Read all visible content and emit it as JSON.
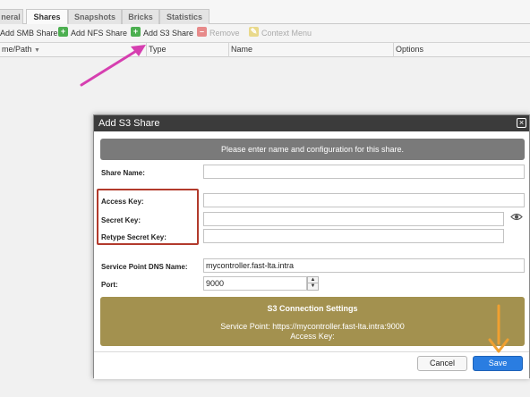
{
  "tabs": [
    "neral",
    "Shares",
    "Snapshots",
    "Bricks",
    "Statistics"
  ],
  "toolbar": {
    "add_smb": "Add SMB Share",
    "add_nfs": "Add NFS Share",
    "add_s3": "Add S3 Share",
    "remove": "Remove",
    "context_menu": "Context Menu"
  },
  "grid": {
    "columns": [
      "me/Path",
      "Type",
      "Name",
      "Options"
    ]
  },
  "dialog": {
    "title": "Add S3 Share",
    "banner": "Please enter name and configuration for this share.",
    "fields": {
      "share_name": {
        "label": "Share Name:",
        "value": ""
      },
      "access_key": {
        "label": "Access Key:",
        "value": ""
      },
      "secret_key": {
        "label": "Secret Key:",
        "value": ""
      },
      "retype_secret_key": {
        "label": "Retype Secret Key:",
        "value": ""
      },
      "service_point_dns": {
        "label": "Service Point DNS Name:",
        "value": "mycontroller.fast-lta.intra"
      },
      "port": {
        "label": "Port:",
        "value": "9000"
      }
    },
    "connection": {
      "title": "S3 Connection Settings",
      "service_point": "Service Point: https://mycontroller.fast-lta.intra:9000",
      "access_key": "Access Key:"
    },
    "buttons": {
      "cancel": "Cancel",
      "save": "Save"
    }
  },
  "colors": {
    "annotation_pink": "#d63fb0",
    "annotation_orange": "#f0a030",
    "highlight_red": "#b23a2c",
    "connection_panel": "#a3914f",
    "save_blue": "#2a7de1"
  }
}
